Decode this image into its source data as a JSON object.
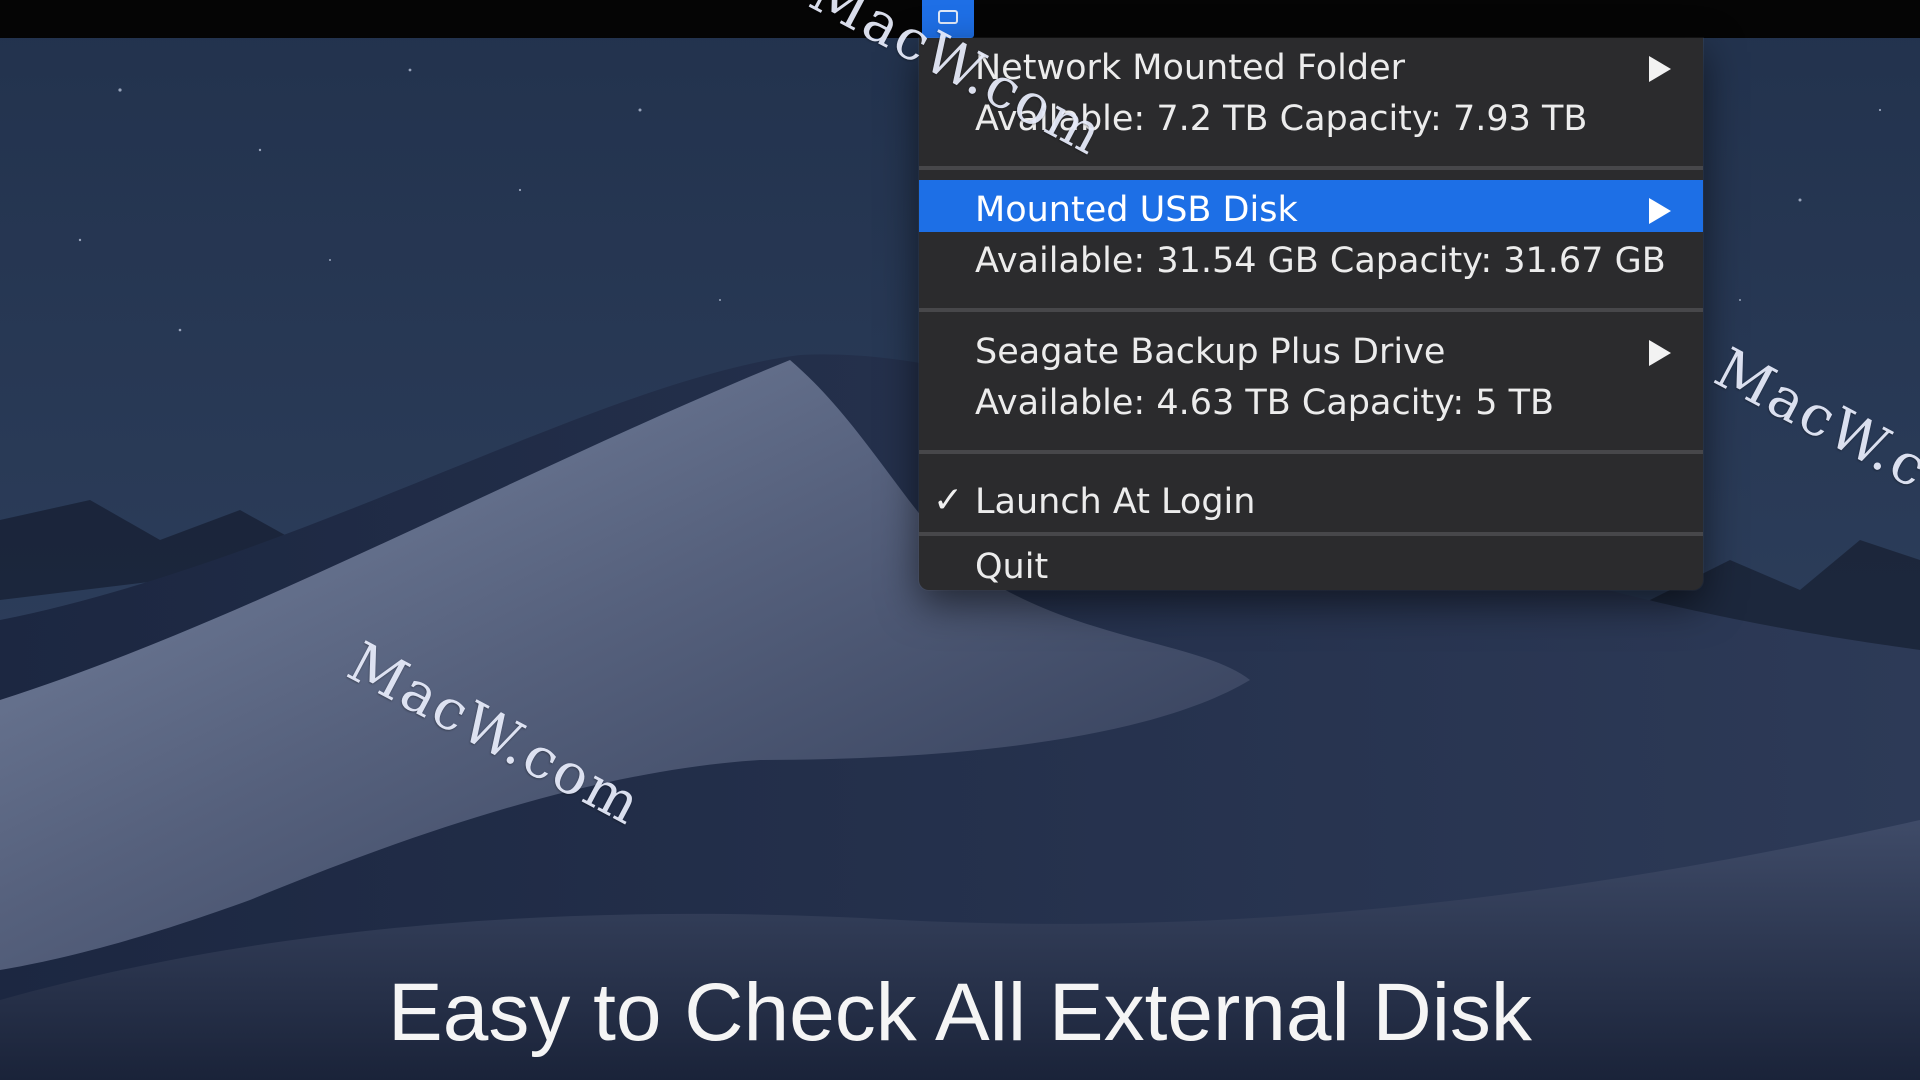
{
  "menu": {
    "items": [
      {
        "title": "Network Mounted Folder",
        "details": "Available: 7.2 TB  Capacity: 7.93 TB",
        "has_submenu": true,
        "highlighted": false
      },
      {
        "title": "Mounted USB Disk",
        "details": "Available: 31.54 GB  Capacity: 31.67 GB",
        "has_submenu": true,
        "highlighted": true
      },
      {
        "title": "Seagate Backup Plus Drive",
        "details": "Available: 4.63 TB  Capacity: 5 TB",
        "has_submenu": true,
        "highlighted": false
      }
    ],
    "launch_at_login": {
      "checkmark": "✓",
      "label": "Launch At Login",
      "checked": true
    },
    "quit_label": "Quit"
  },
  "caption": "Easy to Check All External Disk",
  "watermark": "MacW.com",
  "colors": {
    "menu_background": "#2b2b2d",
    "highlight": "#1d6fe6",
    "menubar": "#050505"
  },
  "icons": {
    "status_item": "external-disk-icon",
    "submenu_arrow": "triangle-right-icon"
  }
}
